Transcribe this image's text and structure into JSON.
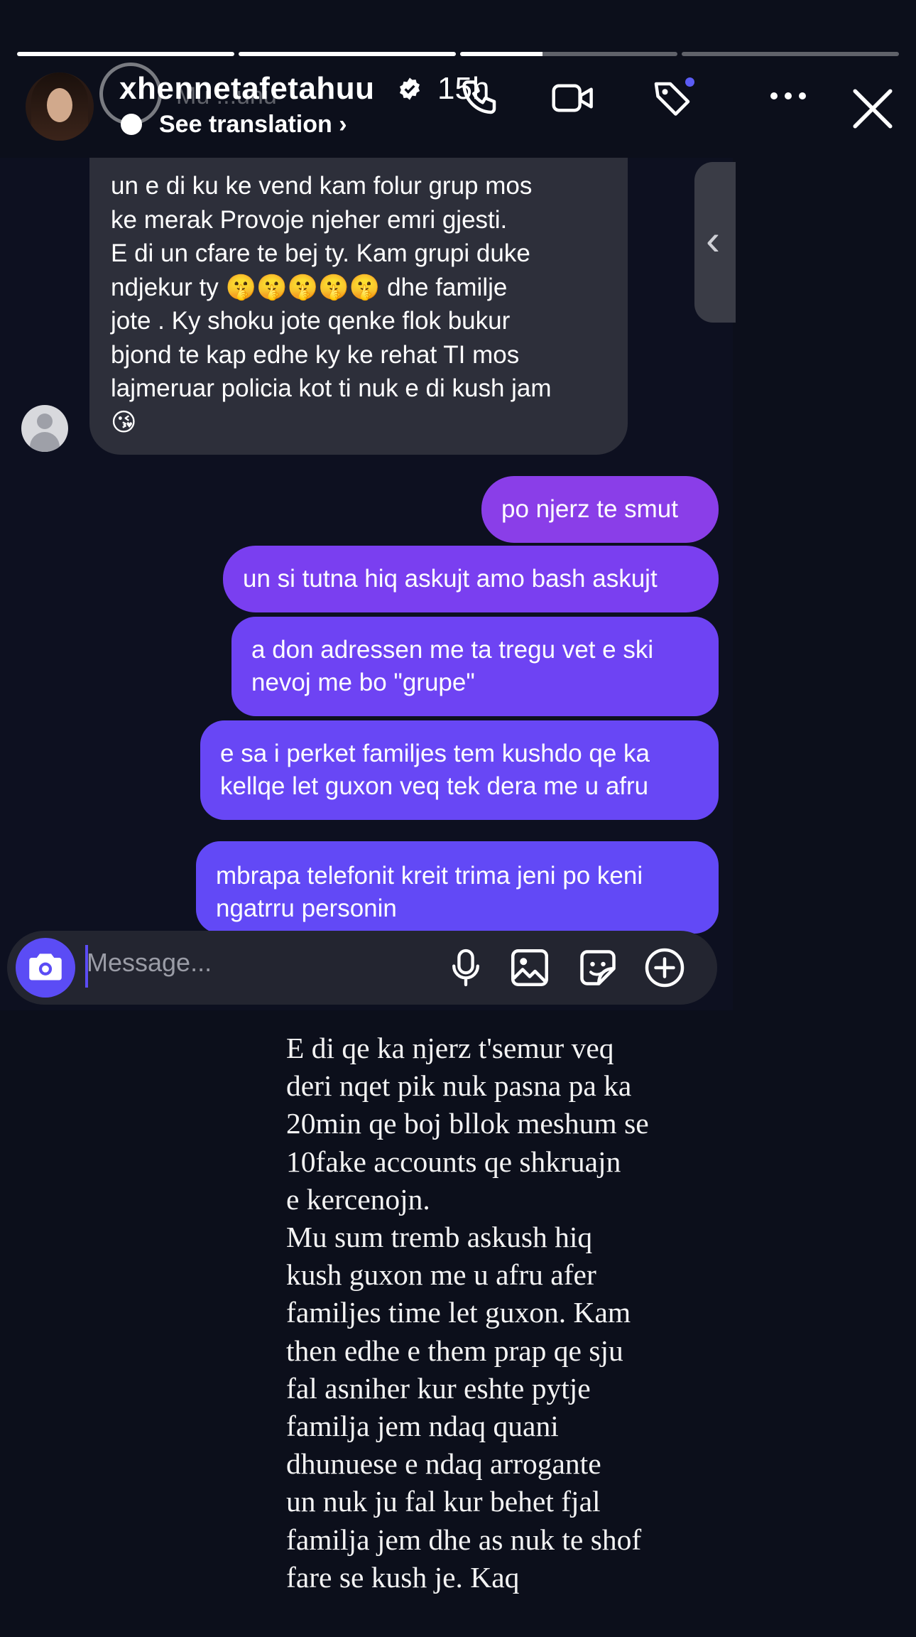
{
  "story": {
    "progress": [
      1,
      1,
      0.38,
      0
    ],
    "username": "xhennetafetahuu",
    "time": "15h",
    "see_translation": "See translation",
    "see_translation_chevron": "›",
    "ghost_text": "Mu ...unu"
  },
  "chat": {
    "incoming": "un e di ku ke vend  kam folur grup mos\nke merak        Provoje njeher emri gjesti.\nE di un cfare te bej ty.  Kam grupi  duke\nndjekur ty 🤫🤫🤫🤫🤫 dhe familje\njote .  Ky shoku jote qenke flok bukur\nbjond  te kap edhe ky ke rehat TI  mos\nlajmeruar policia kot  ti nuk e di kush jam\n😘",
    "outgoing": [
      "po njerz te smut",
      "un si tutna hiq askujt amo bash askujt",
      "a don adressen me ta tregu vet e ski\nnevoj me bo \"grupe\"",
      "e sa i perket familjes tem kushdo qe ka\nkellqe let guxon veq tek dera me u afru",
      "mbrapa telefonit kreit trima jeni po keni\nngatrru personin"
    ],
    "composer_placeholder": "Message..."
  },
  "caption": "E di qe ka njerz t'semur veq\nderi nqet pik nuk pasna pa ka\n20min qe boj bllok meshum se\n10fake accounts qe shkruajn\ne kercenojn.\nMu sum tremb askush hiq\nkush guxon me u afru afer\nfamiljes time let guxon. Kam\nthen edhe e them prap qe sju\nfal asniher kur eshte pytje\nfamilja jem ndaq quani\ndhunuese e ndaq arrogante\nun nuk ju fal kur behet fjal\nfamilja jem dhe as nuk te shof\nfare se kush je. Kaq",
  "icons": {
    "header": [
      "phone-icon",
      "video-icon",
      "tag-icon",
      "more-icon",
      "close-icon"
    ],
    "composer": [
      "camera-icon",
      "mic-icon",
      "image-icon",
      "sticker-icon",
      "plus-icon"
    ]
  },
  "colors": {
    "background": "#0c0f1b",
    "incoming_bubble": "#2d2f3a",
    "outgoing_bubble": "#7740f0",
    "accent": "#5b4cf5",
    "notification_dot": "#5b5cf5"
  }
}
